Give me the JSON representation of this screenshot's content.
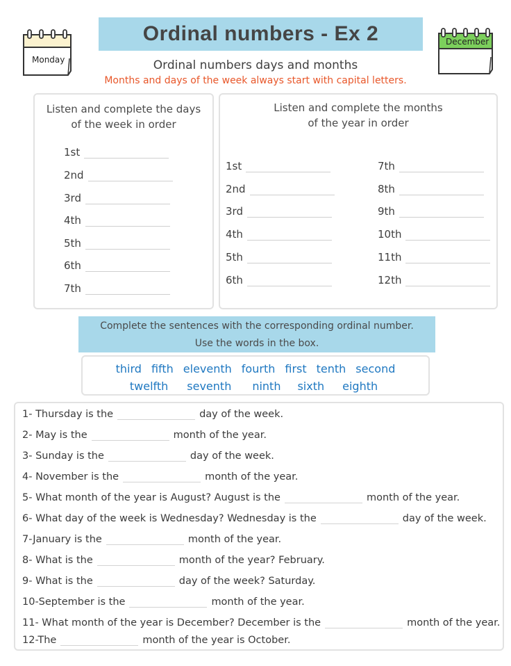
{
  "header": {
    "title": "Ordinal numbers - Ex 2",
    "subtitle": "Ordinal numbers days and months",
    "note": "Months and days of the week always start with capital letters.",
    "left_calendar_label": "Monday",
    "right_calendar_label": "December"
  },
  "colors": {
    "title_bg": "#a8d8ea",
    "note": "#e8572a",
    "word_bank": "#1f78c1",
    "monday_calendar_top": "#fbf2cf",
    "december_calendar_top": "#7ccf5c"
  },
  "days_panel": {
    "heading_line1": "Listen and complete the days",
    "heading_line2": "of the week in order",
    "items": [
      "1st",
      "2nd",
      "3rd",
      "4th",
      "5th",
      "6th",
      "7th"
    ]
  },
  "months_panel": {
    "heading_line1": "Listen and complete the months",
    "heading_line2": "of the year in order",
    "left_items": [
      "1st",
      "2nd",
      "3rd",
      "4th",
      "5th",
      "6th"
    ],
    "right_items": [
      "7th",
      "8th",
      "9th",
      "10th",
      "11th",
      "12th"
    ]
  },
  "instructions": {
    "line1": "Complete the sentences with the corresponding ordinal number.",
    "line2": "Use the words in the box."
  },
  "word_bank": {
    "row1": [
      "third",
      "fifth",
      "eleventh",
      "fourth",
      "first",
      "tenth",
      "second"
    ],
    "row2": [
      "twelfth",
      "seventh",
      "ninth",
      "sixth",
      "eighth"
    ]
  },
  "sentences": [
    {
      "before": "1- Thursday is the",
      "after": "day of the week."
    },
    {
      "before": "2- May is the",
      "after": "month of the year."
    },
    {
      "before": "3- Sunday is the",
      "after": "day of the week."
    },
    {
      "before": "4- November is the",
      "after": "month of the year."
    },
    {
      "before": "5- What month of the year is August? August is the",
      "after": "month of the year."
    },
    {
      "before": "6- What day of the week is Wednesday? Wednesday is the",
      "after": "day of the week."
    },
    {
      "before": "7-January is the",
      "after": "month of the year."
    },
    {
      "before": "8- What is the",
      "after": "month of the year? February."
    },
    {
      "before": "9- What is the",
      "after": "day of the week? Saturday."
    },
    {
      "before": "10-September is the",
      "after": "month of the year."
    },
    {
      "before": "11- What month of the year is December? December is the",
      "after": "month of the year."
    },
    {
      "before": "12-The",
      "after": "month of the year is October."
    }
  ]
}
